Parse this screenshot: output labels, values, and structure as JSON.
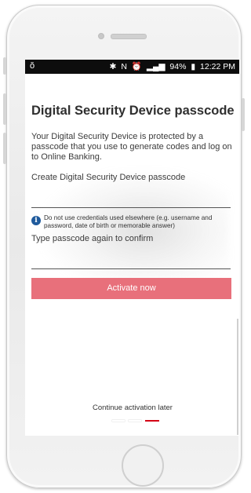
{
  "status_bar": {
    "left_icon": "notification-icon",
    "bluetooth_icon": "bluetooth-icon",
    "nfc_icon": "nfc-icon",
    "alarm_icon": "alarm-icon",
    "signal_icon": "signal-icon",
    "battery": "94%",
    "battery_icon": "battery-icon",
    "time": "12:22 PM"
  },
  "page": {
    "title": "Digital Security Device passcode",
    "description": "Your Digital Security Device is protected by a passcode that you use to generate codes and log on to Online Banking.",
    "create_label": "Create Digital Security Device passcode",
    "create_value": "",
    "info_icon": "info-icon",
    "info_text": "Do not use credentials used elsewhere (e.g. username and password, date of birth or memorable answer)",
    "confirm_label": "Type passcode again to confirm",
    "confirm_value": "",
    "activate_button": "Activate now",
    "continue_later": "Continue activation later"
  },
  "pagination": {
    "total": 3,
    "active": 3
  },
  "colors": {
    "accent": "#e8707b",
    "active_dot": "#d40015",
    "status_bar": "#0d0d0d",
    "info_icon": "#1f5a9c"
  }
}
